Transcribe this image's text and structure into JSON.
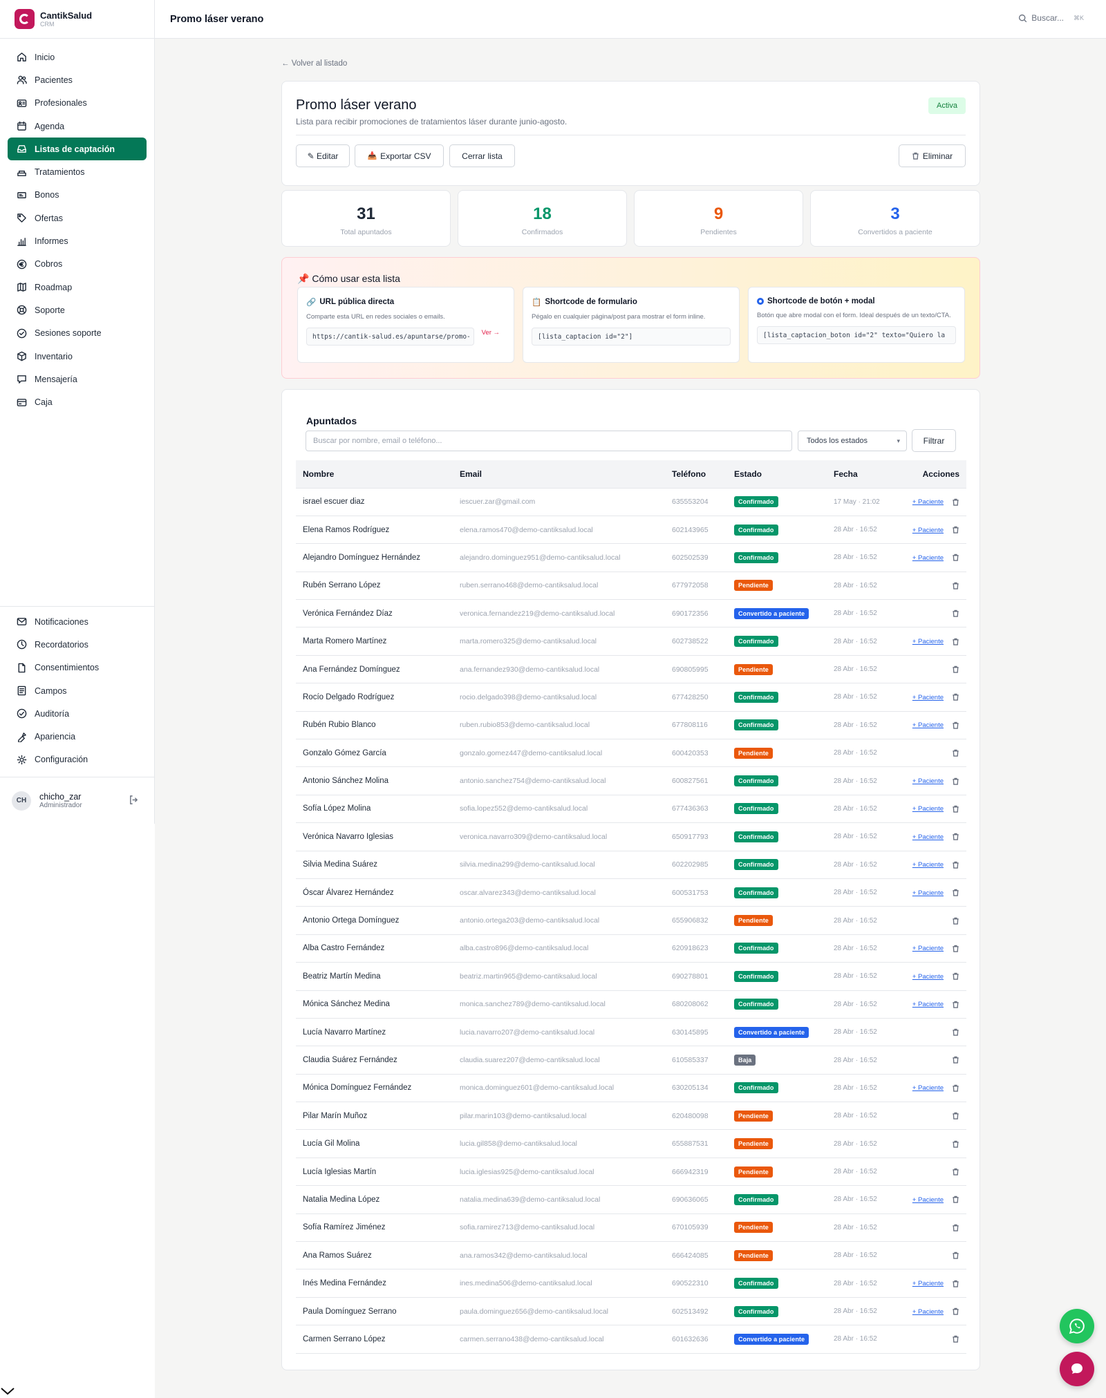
{
  "brand": {
    "name": "CantikSalud",
    "sub": "CRM"
  },
  "colors": {
    "primary": "#047857",
    "brand": "#c2185b",
    "confirmado": "#059669",
    "pendiente": "#ea580c",
    "convertido": "#2563eb",
    "baja": "#6b7280"
  },
  "nav": [
    {
      "label": "Inicio",
      "icon": "home-icon",
      "active": false
    },
    {
      "label": "Pacientes",
      "icon": "users-icon",
      "active": false
    },
    {
      "label": "Profesionales",
      "icon": "id-card-icon",
      "active": false
    },
    {
      "label": "Agenda",
      "icon": "calendar-icon",
      "active": false
    },
    {
      "label": "Listas de captación",
      "icon": "inbox-icon",
      "active": true
    },
    {
      "label": "Tratamientos",
      "icon": "spa-icon",
      "active": false
    },
    {
      "label": "Bonos",
      "icon": "ticket-icon",
      "active": false
    },
    {
      "label": "Ofertas",
      "icon": "tag-icon",
      "active": false
    },
    {
      "label": "Informes",
      "icon": "bar-chart-icon",
      "active": false
    },
    {
      "label": "Cobros",
      "icon": "euro-icon",
      "active": false
    },
    {
      "label": "Roadmap",
      "icon": "map-icon",
      "active": false
    },
    {
      "label": "Soporte",
      "icon": "lifebuoy-icon",
      "active": false
    },
    {
      "label": "Sesiones soporte",
      "icon": "support-session-icon",
      "active": false
    },
    {
      "label": "Inventario",
      "icon": "box-icon",
      "active": false
    },
    {
      "label": "Mensajería",
      "icon": "chat-icon",
      "active": false
    },
    {
      "label": "Caja",
      "icon": "cash-register-icon",
      "active": false
    }
  ],
  "nav_bottom": [
    {
      "label": "Notificaciones",
      "icon": "mail-icon"
    },
    {
      "label": "Recordatorios",
      "icon": "clock-icon"
    },
    {
      "label": "Consentimientos",
      "icon": "document-icon"
    },
    {
      "label": "Campos",
      "icon": "form-fields-icon"
    },
    {
      "label": "Auditoría",
      "icon": "shield-check-icon"
    },
    {
      "label": "Apariencia",
      "icon": "palette-icon"
    },
    {
      "label": "Configuración",
      "icon": "gear-icon"
    }
  ],
  "user": {
    "initials": "CH",
    "name": "chicho_zar",
    "role": "Administrador"
  },
  "topbar": {
    "title": "Promo láser verano",
    "search": "Buscar...",
    "shortcut": "⌘K"
  },
  "back": "← Volver al listado",
  "list": {
    "title": "Promo láser verano",
    "description": "Lista para recibir promociones de tratamientos láser durante junio-agosto.",
    "status": "Activa"
  },
  "actions": {
    "edit": "✎ Editar",
    "export": "Exportar CSV",
    "close": "Cerrar lista",
    "delete": "Eliminar"
  },
  "stats": [
    {
      "value": "31",
      "label": "Total apuntados",
      "color": "#111827"
    },
    {
      "value": "18",
      "label": "Confirmados",
      "color": "#059669"
    },
    {
      "value": "9",
      "label": "Pendientes",
      "color": "#ea580c"
    },
    {
      "value": "3",
      "label": "Convertidos a paciente",
      "color": "#2563eb"
    }
  ],
  "howto": {
    "title": "Cómo usar esta lista",
    "cards": [
      {
        "title": "URL pública directa",
        "desc": "Comparte esta URL en redes sociales o emails.",
        "code": "https://cantik-salud.es/apuntarse/promo-",
        "link": "Ver →"
      },
      {
        "title": "Shortcode de formulario",
        "desc": "Pégalo en cualquier página/post para mostrar el form inline.",
        "code": "[lista_captacion id=\"2\"]"
      },
      {
        "title": "Shortcode de botón + modal",
        "desc": "Botón que abre modal con el form. Ideal después de un texto/CTA.",
        "code": "[lista_captacion_boton id=\"2\" texto=\"Quiero la"
      }
    ]
  },
  "apuntados": {
    "title": "Apuntados",
    "search_placeholder": "Buscar por nombre, email o teléfono...",
    "filter_value": "Todos los estados",
    "filter_button": "Filtrar",
    "columns": [
      "Nombre",
      "Email",
      "Teléfono",
      "Estado",
      "Fecha",
      "Acciones"
    ],
    "patient_link": "+ Paciente",
    "rows": [
      {
        "name": "israel escuer diaz",
        "email": "iescuer.zar@gmail.com",
        "phone": "635553204",
        "status": "Confirmado",
        "date": "17 May · 21:02"
      },
      {
        "name": "Elena Ramos Rodríguez",
        "email": "elena.ramos470@demo-cantiksalud.local",
        "phone": "602143965",
        "status": "Confirmado",
        "date": "28 Abr · 16:52"
      },
      {
        "name": "Alejandro Domínguez Hernández",
        "email": "alejandro.dominguez951@demo-cantiksalud.local",
        "phone": "602502539",
        "status": "Confirmado",
        "date": "28 Abr · 16:52"
      },
      {
        "name": "Rubén Serrano López",
        "email": "ruben.serrano468@demo-cantiksalud.local",
        "phone": "677972058",
        "status": "Pendiente",
        "date": "28 Abr · 16:52"
      },
      {
        "name": "Verónica Fernández Díaz",
        "email": "veronica.fernandez219@demo-cantiksalud.local",
        "phone": "690172356",
        "status": "Convertido a paciente",
        "date": "28 Abr · 16:52"
      },
      {
        "name": "Marta Romero Martínez",
        "email": "marta.romero325@demo-cantiksalud.local",
        "phone": "602738522",
        "status": "Confirmado",
        "date": "28 Abr · 16:52"
      },
      {
        "name": "Ana Fernández Domínguez",
        "email": "ana.fernandez930@demo-cantiksalud.local",
        "phone": "690805995",
        "status": "Pendiente",
        "date": "28 Abr · 16:52"
      },
      {
        "name": "Rocío Delgado Rodríguez",
        "email": "rocio.delgado398@demo-cantiksalud.local",
        "phone": "677428250",
        "status": "Confirmado",
        "date": "28 Abr · 16:52"
      },
      {
        "name": "Rubén Rubio Blanco",
        "email": "ruben.rubio853@demo-cantiksalud.local",
        "phone": "677808116",
        "status": "Confirmado",
        "date": "28 Abr · 16:52"
      },
      {
        "name": "Gonzalo Gómez García",
        "email": "gonzalo.gomez447@demo-cantiksalud.local",
        "phone": "600420353",
        "status": "Pendiente",
        "date": "28 Abr · 16:52"
      },
      {
        "name": "Antonio Sánchez Molina",
        "email": "antonio.sanchez754@demo-cantiksalud.local",
        "phone": "600827561",
        "status": "Confirmado",
        "date": "28 Abr · 16:52"
      },
      {
        "name": "Sofía López Molina",
        "email": "sofia.lopez552@demo-cantiksalud.local",
        "phone": "677436363",
        "status": "Confirmado",
        "date": "28 Abr · 16:52"
      },
      {
        "name": "Verónica Navarro Iglesias",
        "email": "veronica.navarro309@demo-cantiksalud.local",
        "phone": "650917793",
        "status": "Confirmado",
        "date": "28 Abr · 16:52"
      },
      {
        "name": "Silvia Medina Suárez",
        "email": "silvia.medina299@demo-cantiksalud.local",
        "phone": "602202985",
        "status": "Confirmado",
        "date": "28 Abr · 16:52"
      },
      {
        "name": "Óscar Álvarez Hernández",
        "email": "oscar.alvarez343@demo-cantiksalud.local",
        "phone": "600531753",
        "status": "Confirmado",
        "date": "28 Abr · 16:52"
      },
      {
        "name": "Antonio Ortega Domínguez",
        "email": "antonio.ortega203@demo-cantiksalud.local",
        "phone": "655906832",
        "status": "Pendiente",
        "date": "28 Abr · 16:52"
      },
      {
        "name": "Alba Castro Fernández",
        "email": "alba.castro896@demo-cantiksalud.local",
        "phone": "620918623",
        "status": "Confirmado",
        "date": "28 Abr · 16:52"
      },
      {
        "name": "Beatriz Martín Medina",
        "email": "beatriz.martin965@demo-cantiksalud.local",
        "phone": "690278801",
        "status": "Confirmado",
        "date": "28 Abr · 16:52"
      },
      {
        "name": "Mónica Sánchez Medina",
        "email": "monica.sanchez789@demo-cantiksalud.local",
        "phone": "680208062",
        "status": "Confirmado",
        "date": "28 Abr · 16:52"
      },
      {
        "name": "Lucía Navarro Martínez",
        "email": "lucia.navarro207@demo-cantiksalud.local",
        "phone": "630145895",
        "status": "Convertido a paciente",
        "date": "28 Abr · 16:52"
      },
      {
        "name": "Claudia Suárez Fernández",
        "email": "claudia.suarez207@demo-cantiksalud.local",
        "phone": "610585337",
        "status": "Baja",
        "date": "28 Abr · 16:52"
      },
      {
        "name": "Mónica Domínguez Fernández",
        "email": "monica.dominguez601@demo-cantiksalud.local",
        "phone": "630205134",
        "status": "Confirmado",
        "date": "28 Abr · 16:52"
      },
      {
        "name": "Pilar Marín Muñoz",
        "email": "pilar.marin103@demo-cantiksalud.local",
        "phone": "620480098",
        "status": "Pendiente",
        "date": "28 Abr · 16:52"
      },
      {
        "name": "Lucía Gil Molina",
        "email": "lucia.gil858@demo-cantiksalud.local",
        "phone": "655887531",
        "status": "Pendiente",
        "date": "28 Abr · 16:52"
      },
      {
        "name": "Lucía Iglesias Martín",
        "email": "lucia.iglesias925@demo-cantiksalud.local",
        "phone": "666942319",
        "status": "Pendiente",
        "date": "28 Abr · 16:52"
      },
      {
        "name": "Natalia Medina López",
        "email": "natalia.medina639@demo-cantiksalud.local",
        "phone": "690636065",
        "status": "Confirmado",
        "date": "28 Abr · 16:52"
      },
      {
        "name": "Sofía Ramírez Jiménez",
        "email": "sofia.ramirez713@demo-cantiksalud.local",
        "phone": "670105939",
        "status": "Pendiente",
        "date": "28 Abr · 16:52"
      },
      {
        "name": "Ana Ramos Suárez",
        "email": "ana.ramos342@demo-cantiksalud.local",
        "phone": "666424085",
        "status": "Pendiente",
        "date": "28 Abr · 16:52"
      },
      {
        "name": "Inés Medina Fernández",
        "email": "ines.medina506@demo-cantiksalud.local",
        "phone": "690522310",
        "status": "Confirmado",
        "date": "28 Abr · 16:52"
      },
      {
        "name": "Paula Domínguez Serrano",
        "email": "paula.dominguez656@demo-cantiksalud.local",
        "phone": "602513492",
        "status": "Confirmado",
        "date": "28 Abr · 16:52"
      },
      {
        "name": "Carmen Serrano López",
        "email": "carmen.serrano438@demo-cantiksalud.local",
        "phone": "601632636",
        "status": "Convertido a paciente",
        "date": "28 Abr · 16:52"
      }
    ]
  }
}
